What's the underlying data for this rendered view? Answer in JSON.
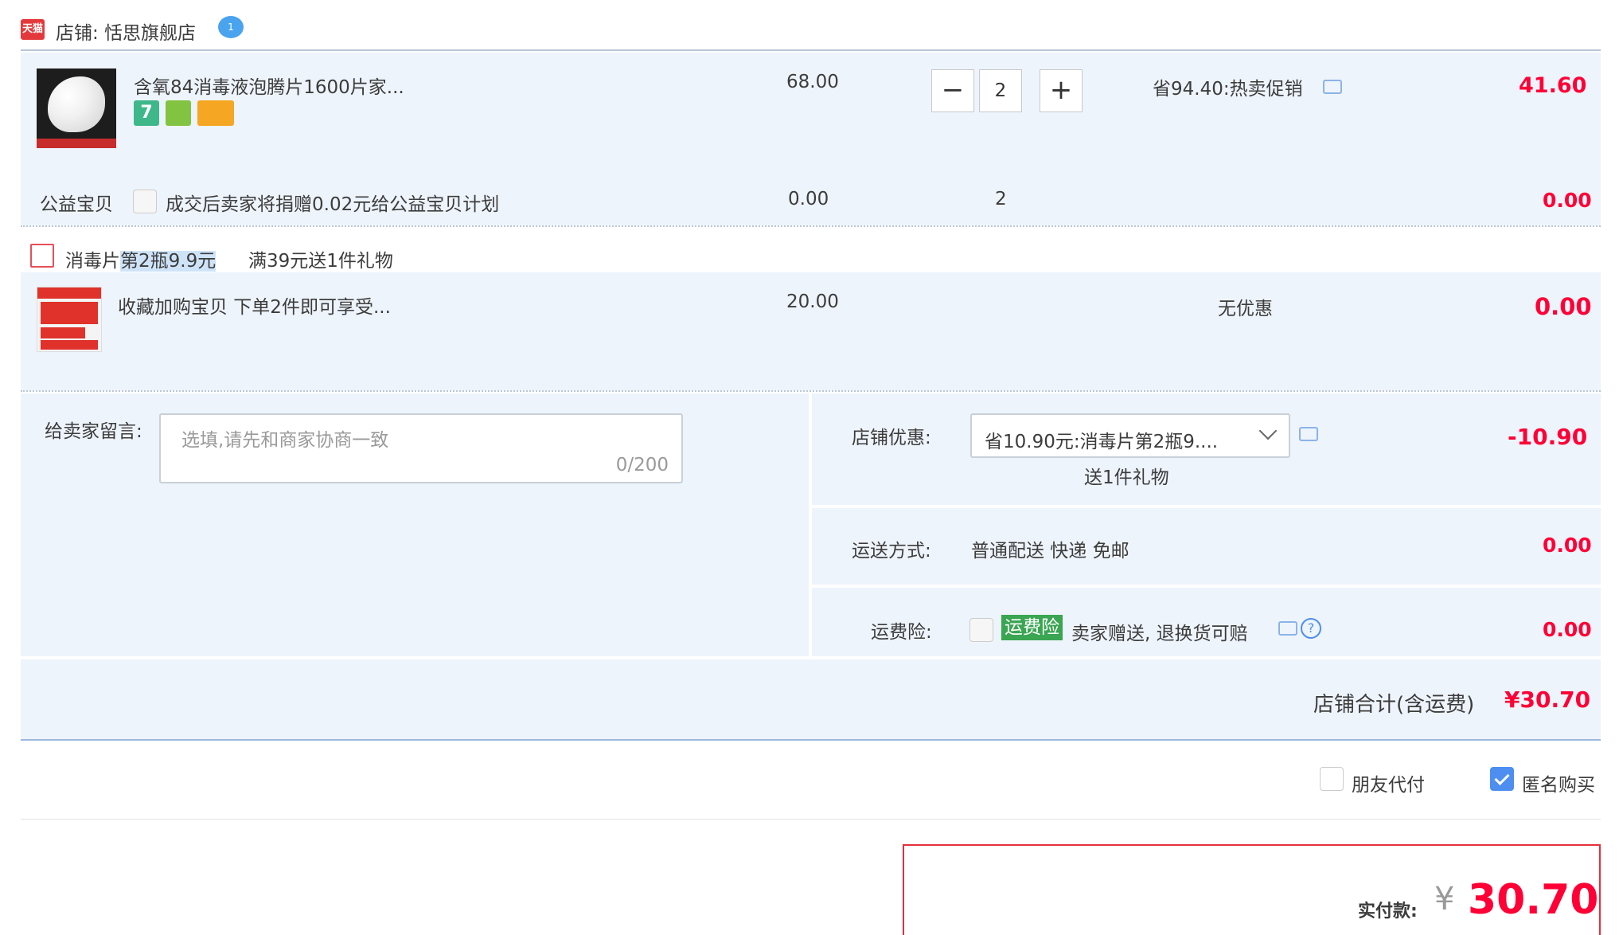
{
  "shop": {
    "logo_text": "天猫",
    "name": "店铺: 恬思旗舰店",
    "ww_icon_text": "1"
  },
  "item1": {
    "title": "含氧84消毒液泡腾片1600片家...",
    "price": "68.00",
    "quantity": "2",
    "minus": "−",
    "plus": "+",
    "promo": "省94.40:热卖促销",
    "subtotal": "41.60",
    "badge1": "7"
  },
  "charity": {
    "label": "公益宝贝",
    "text": "成交后卖家将捐赠0.02元给公益宝贝计划",
    "price": "0.00",
    "quantity": "2",
    "subtotal": "0.00"
  },
  "gift_promo": {
    "prefix": "消毒片",
    "highlight": "第2瓶9.9元",
    "full_gift": "满39元送1件礼物"
  },
  "item2": {
    "title": "收藏加购宝贝 下单2件即可享受...",
    "price": "20.00",
    "promo": "无优惠",
    "subtotal": "0.00"
  },
  "memo": {
    "label": "给卖家留言:",
    "placeholder": "选填,请先和商家协商一致",
    "counter": "0/200"
  },
  "shop_discount": {
    "label": "店铺优惠:",
    "selected": "省10.90元:消毒片第2瓶9....",
    "sub": "送1件礼物",
    "amount": "-10.90"
  },
  "shipping": {
    "label": "运送方式:",
    "value": "普通配送 快递 免邮",
    "amount": "0.00"
  },
  "insurance": {
    "label": "运费险:",
    "tag": "运费险",
    "text": "卖家赠送, 退换货可赔",
    "amount": "0.00"
  },
  "shop_total": {
    "label": "店铺合计(含运费)",
    "amount": "¥30.70"
  },
  "options": {
    "friend_pay": "朋友代付",
    "anonymous": "匿名购买"
  },
  "payment": {
    "label": "实付款:",
    "currency": "¥",
    "amount": "30.70"
  },
  "colors": {
    "price_red": "#ff0036",
    "panel_blue": "#eef4fb",
    "check_blue": "#4d8ef0",
    "insurance_green": "#3aa552"
  }
}
